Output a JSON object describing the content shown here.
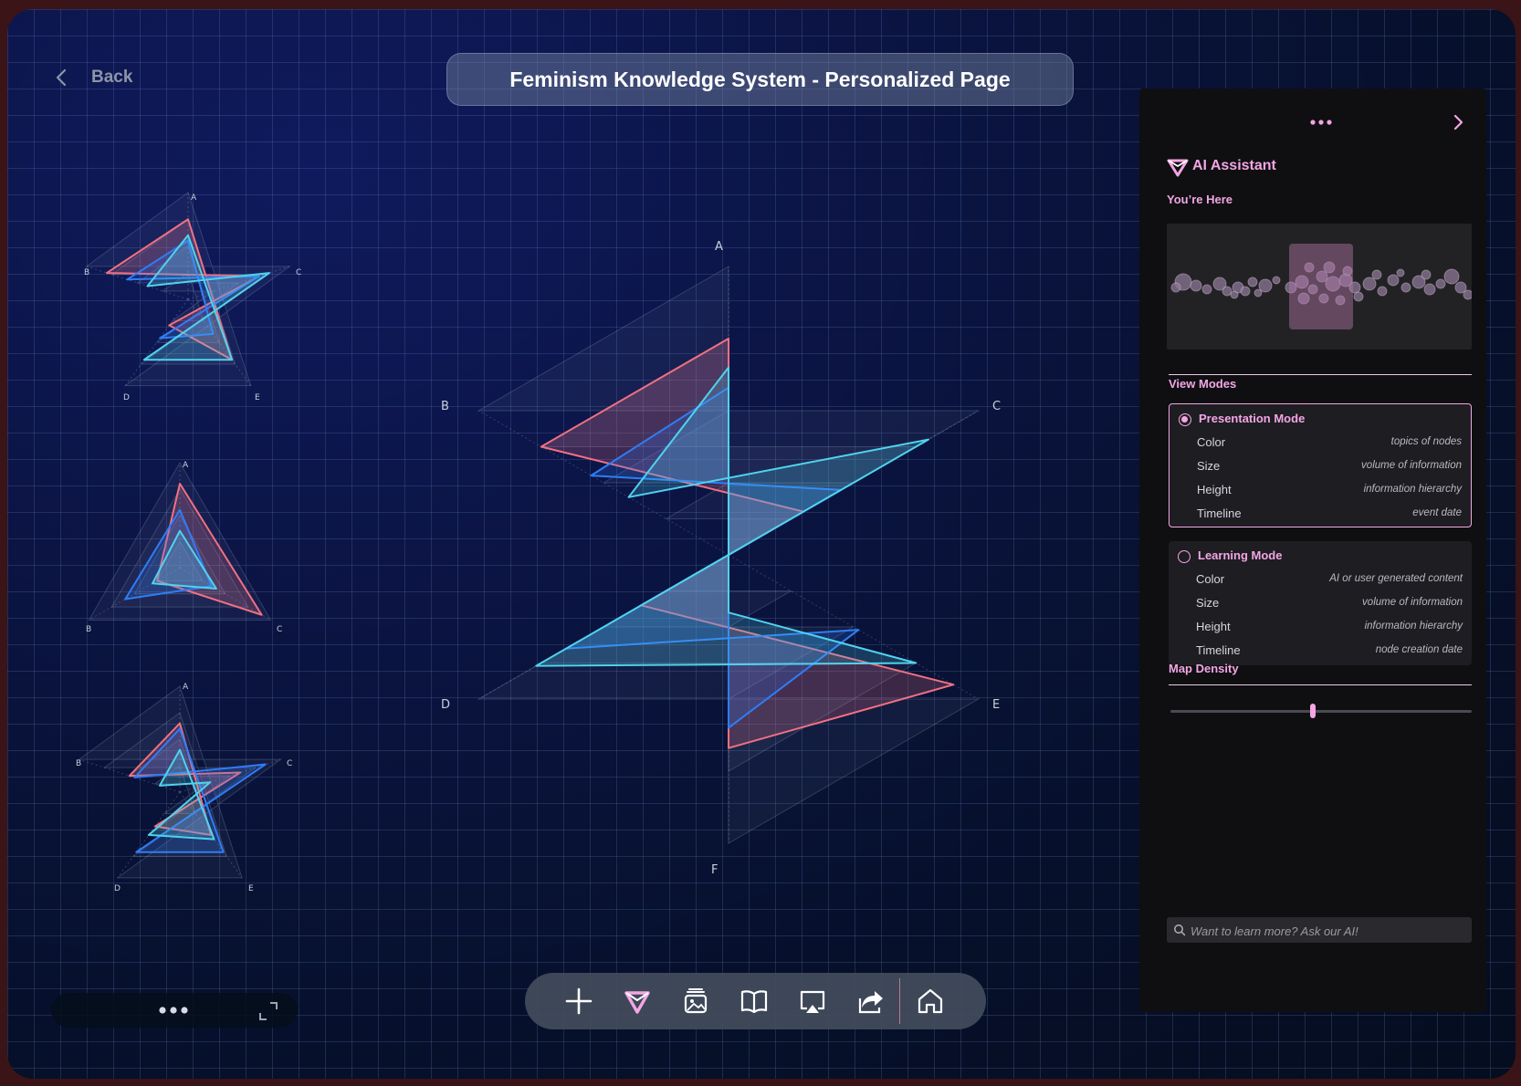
{
  "nav": {
    "back_label": "Back"
  },
  "header": {
    "title": "Feminism Knowledge System - Personalized Page"
  },
  "colors": {
    "accent": "#f3a6e3",
    "series_red": "#f07182",
    "series_blue": "#2f7df6",
    "series_cyan": "#4fd3ee"
  },
  "chart_data": [
    {
      "type": "radar",
      "axes": [
        "A",
        "B",
        "C",
        "D",
        "E"
      ],
      "series": [
        {
          "values": [
            0.75,
            0.8,
            0.7,
            0.3,
            0.7
          ]
        },
        {
          "values": [
            0.55,
            0.6,
            0.7,
            0.45,
            0.4
          ]
        },
        {
          "values": [
            0.6,
            0.4,
            0.8,
            0.7,
            0.7
          ]
        }
      ]
    },
    {
      "type": "radar",
      "axes": [
        "A",
        "B",
        "C"
      ],
      "series": [
        {
          "values": [
            0.8,
            0.25,
            0.9
          ]
        },
        {
          "values": [
            0.55,
            0.6,
            0.35
          ]
        },
        {
          "values": [
            0.35,
            0.3,
            0.4
          ]
        }
      ]
    },
    {
      "type": "radar",
      "axes": [
        "A",
        "B",
        "C",
        "D",
        "E"
      ],
      "series": [
        {
          "values": [
            0.65,
            0.5,
            0.6,
            0.4,
            0.5
          ]
        },
        {
          "values": [
            0.6,
            0.45,
            0.85,
            0.7,
            0.7
          ]
        },
        {
          "values": [
            0.4,
            0.2,
            0.3,
            0.5,
            0.55
          ]
        }
      ]
    },
    {
      "type": "radar",
      "axes": [
        "A",
        "B",
        "C",
        "D",
        "E",
        "F"
      ],
      "series": [
        {
          "values": [
            0.75,
            0.75,
            0.3,
            0.35,
            0.9,
            0.67
          ]
        },
        {
          "values": [
            0.58,
            0.55,
            0.45,
            0.65,
            0.52,
            0.6
          ]
        },
        {
          "values": [
            0.65,
            0.4,
            0.8,
            0.77,
            0.75,
            0.2
          ]
        }
      ]
    }
  ],
  "assistant": {
    "title": "AI Assistant",
    "location_label": "You’re Here",
    "view_modes_label": "View Modes",
    "presentation": {
      "label": "Presentation Mode",
      "selected": true,
      "rows": [
        {
          "key": "Color",
          "value": "topics of nodes"
        },
        {
          "key": "Size",
          "value": "volume of information"
        },
        {
          "key": "Height",
          "value": "information hierarchy"
        },
        {
          "key": "Timeline",
          "value": "event date"
        }
      ]
    },
    "learning": {
      "label": "Learning Mode",
      "selected": false,
      "rows": [
        {
          "key": "Color",
          "value": "AI or user generated content"
        },
        {
          "key": "Size",
          "value": "volume of information"
        },
        {
          "key": "Height",
          "value": "information hierarchy"
        },
        {
          "key": "Timeline",
          "value": "node creation date"
        }
      ]
    },
    "density_label": "Map Density",
    "density_value": 0.5,
    "ask_placeholder": "Want to learn more? Ask our AI!"
  },
  "toolbar": {
    "items": [
      "add-icon",
      "ai-logo-icon",
      "gallery-icon",
      "book-icon",
      "present-icon",
      "share-icon",
      "home-icon"
    ]
  }
}
